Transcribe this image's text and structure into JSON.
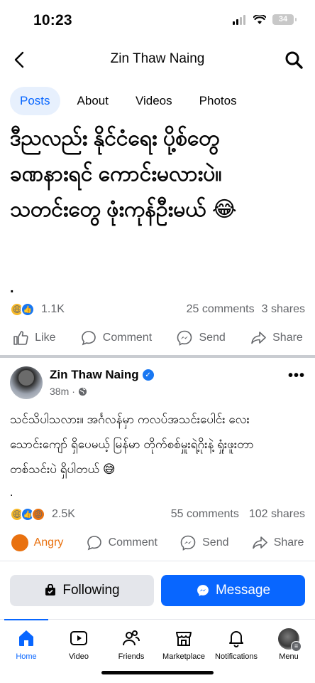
{
  "status_bar": {
    "time": "10:23",
    "battery": "34"
  },
  "header": {
    "title": "Zin Thaw Naing"
  },
  "tabs": [
    {
      "label": "Posts"
    },
    {
      "label": "About"
    },
    {
      "label": "Videos"
    },
    {
      "label": "Photos"
    }
  ],
  "post1": {
    "text_line1": "ဒီညလည်း နိုင်ငံရေး ပို့စ်တွေ",
    "text_line2": "ခဏနားရင် ကောင်းမလားပဲ။",
    "text_line3": "သတင်းတွေ ဖုံးကုန်ဦးမယ် 😂",
    "dot": ".",
    "reaction_count": "1.1K",
    "comments": "25 comments",
    "shares": "3 shares",
    "actions": {
      "like": "Like",
      "comment": "Comment",
      "send": "Send",
      "share": "Share"
    }
  },
  "post2": {
    "author": "Zin Thaw Naing",
    "time": "38m",
    "text_line1": "သင်သိပါသလား။ အင်္ဂလန်မှာ ကလပ်အသင်းပေါင်း လေး",
    "text_line2": "သောင်းကျော် ရှိပေမယ့် မြန်မာ တိုက်စစ်မှူးရဲ့ဂိုးနဲ့ ရှုံးဖူးတာ",
    "text_line3": "တစ်သင်းပဲ ရှိပါတယ် 😅",
    "dot": ".",
    "reaction_count": "2.5K",
    "comments": "55 comments",
    "shares": "102 shares",
    "actions": {
      "reaction": "Angry",
      "comment": "Comment",
      "send": "Send",
      "share": "Share"
    }
  },
  "buttons": {
    "following": "Following",
    "message": "Message"
  },
  "tabbar": [
    {
      "label": "Home",
      "icon": "home-icon"
    },
    {
      "label": "Video",
      "icon": "video-icon"
    },
    {
      "label": "Friends",
      "icon": "friends-icon"
    },
    {
      "label": "Marketplace",
      "icon": "marketplace-icon"
    },
    {
      "label": "Notifications",
      "icon": "bell-icon"
    },
    {
      "label": "Menu",
      "icon": "avatar"
    }
  ],
  "colors": {
    "accent": "#0866ff",
    "angry": "#e9710f",
    "muted": "#65676b"
  }
}
